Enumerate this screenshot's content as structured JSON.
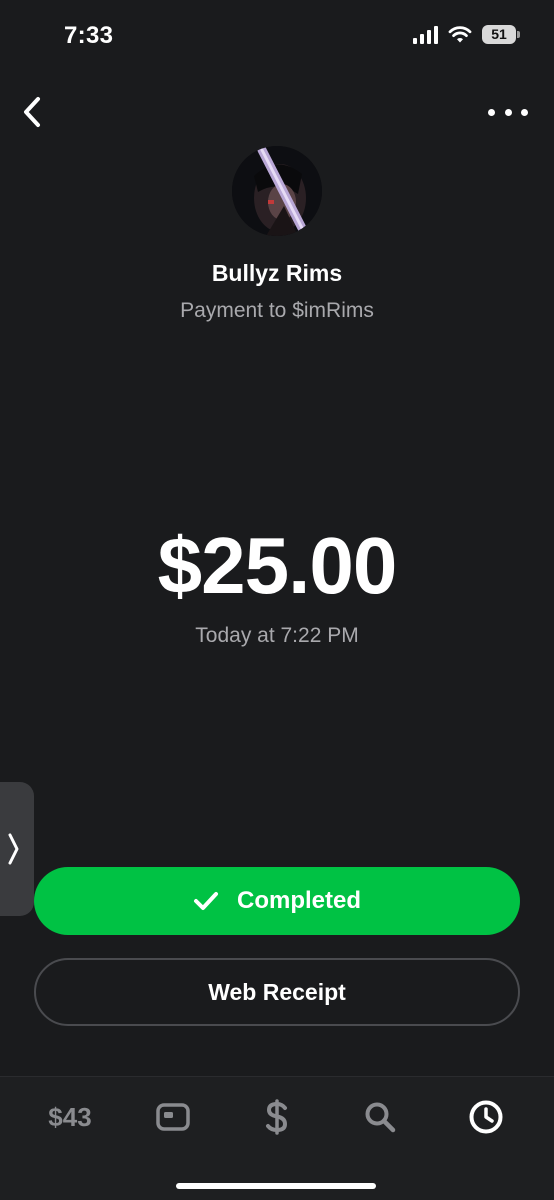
{
  "status_bar": {
    "time": "7:33",
    "battery": "51"
  },
  "nav": {
    "back_icon": "chevron-left-icon",
    "more_icon": "more-horizontal-icon"
  },
  "recipient": {
    "name": "Bullyz Rims",
    "subtitle": "Payment to $imRims"
  },
  "payment": {
    "amount": "$25.00",
    "timestamp": "Today at 7:22 PM"
  },
  "actions": {
    "completed_label": "Completed",
    "receipt_label": "Web Receipt"
  },
  "tab_bar": {
    "balance": "$43",
    "tabs": [
      "card-icon",
      "dollar-icon",
      "search-icon",
      "activity-clock-icon"
    ],
    "active_tab": "activity-clock-icon"
  },
  "colors": {
    "background": "#1a1b1d",
    "accent_green": "#00c244",
    "muted_text": "#a9a9ad",
    "inactive_icon": "#8a8b8f"
  }
}
